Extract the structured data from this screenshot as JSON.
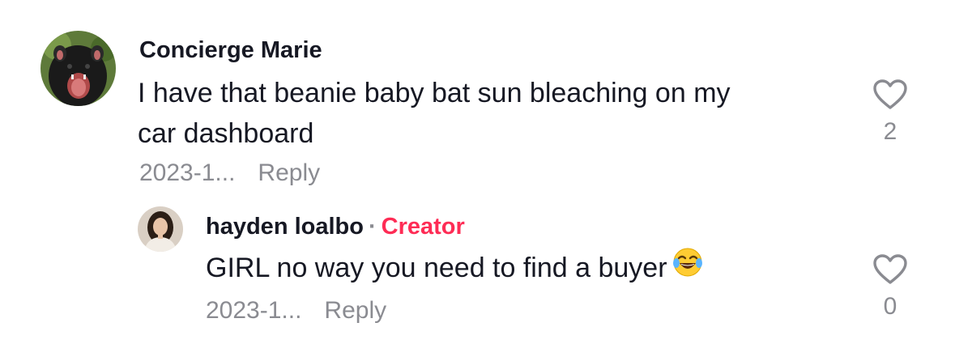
{
  "comments": [
    {
      "username": "Concierge Marie",
      "text_line1": "I have that beanie baby bat sun bleaching on my",
      "text_line2": "car dashboard",
      "date": "2023-1...",
      "reply_label": "Reply",
      "like_count": "2",
      "avatar_icon": "tasmanian-devil-avatar"
    },
    {
      "username": "hayden loalbo",
      "separator": "·",
      "badge": "Creator",
      "text": "GIRL no way you need to find a buyer",
      "emoji_icon": "face-with-tears-of-joy-icon",
      "date": "2023-1...",
      "reply_label": "Reply",
      "like_count": "0",
      "avatar_icon": "woman-portrait-avatar"
    }
  ],
  "colors": {
    "creator_badge": "#fe2c55",
    "secondary_text": "#8a8b91",
    "primary_text": "#161823"
  }
}
